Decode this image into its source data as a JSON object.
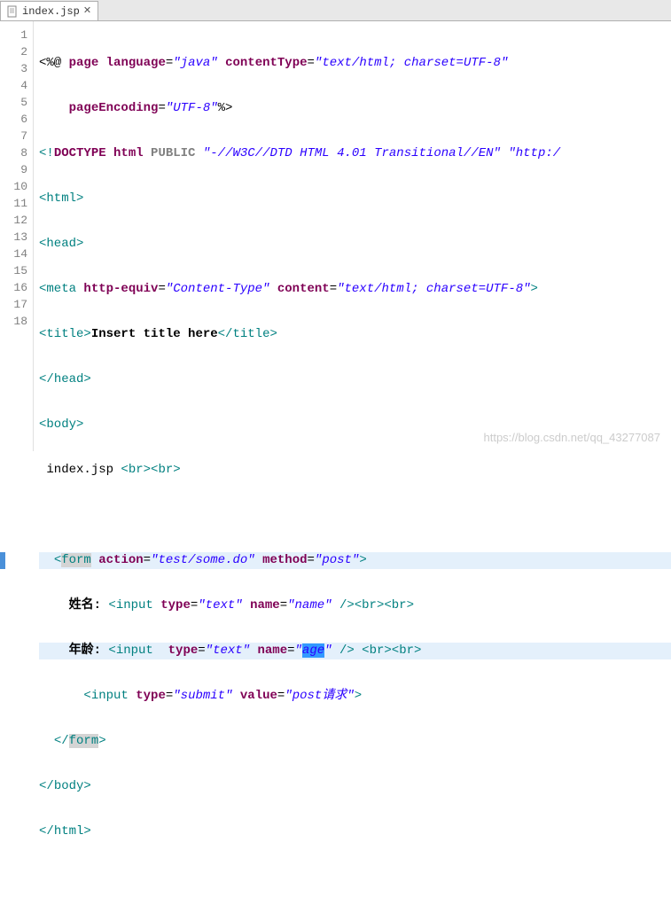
{
  "tab": {
    "filename": "index.jsp",
    "close_icon": "close-icon"
  },
  "watermark": "https://blog.csdn.net/qq_43277087",
  "gutter": {
    "lines": [
      "1",
      "2",
      "3",
      "4",
      "5",
      "6",
      "7",
      "8",
      "9",
      "10",
      "11",
      "12",
      "13",
      "14",
      "15",
      "16",
      "17",
      "18"
    ],
    "fold_at": [
      4,
      9,
      12
    ]
  },
  "code": {
    "l1": {
      "open": "<%@",
      "directive": "page",
      "a1": "language",
      "v1": "\"java\"",
      "a2": "contentType",
      "v2": "\"text/html; charset=UTF-8\""
    },
    "l2": {
      "a1": "pageEncoding",
      "v1": "\"UTF-8\"",
      "close": "%>"
    },
    "l3": {
      "open": "<!",
      "kw": "DOCTYPE",
      "nm": "html",
      "pub": "PUBLIC",
      "v1": "\"-//W3C//DTD HTML 4.01 Transitional//EN\"",
      "v2": "\"http:/"
    },
    "l4": {
      "open": "<",
      "tag": "html",
      "close": ">"
    },
    "l5": {
      "open": "<",
      "tag": "head",
      "close": ">"
    },
    "l6": {
      "open": "<",
      "tag": "meta",
      "a1": "http-equiv",
      "v1": "\"Content-Type\"",
      "a2": "content",
      "v2": "\"text/html; charset=UTF-8\"",
      "close": ">"
    },
    "l7": {
      "open": "<",
      "tag": "title",
      "close": ">",
      "text": "Insert title here",
      "open2": "</",
      "tag2": "title",
      "close2": ">"
    },
    "l8": {
      "open": "</",
      "tag": "head",
      "close": ">"
    },
    "l9": {
      "open": "<",
      "tag": "body",
      "close": ">"
    },
    "l10": {
      "text": "index.jsp ",
      "open": "<",
      "tag": "br",
      "close": "><",
      "tag2": "br",
      "close2": ">"
    },
    "l11": "",
    "l12": {
      "open": "<",
      "tag": "form",
      "a1": "action",
      "v1": "\"test/some.do\"",
      "a2": "method",
      "v2": "\"post\"",
      "close": ">"
    },
    "l13": {
      "label": "姓名: ",
      "open": "<",
      "tag": "input",
      "a1": "type",
      "v1": "\"text\"",
      "a2": "name",
      "v2": "\"name\"",
      "close": "/><",
      "tag2": "br",
      "mid": "><",
      "tag3": "br",
      "close2": ">"
    },
    "l14": {
      "label": "年龄: ",
      "open": "<",
      "tag": "input",
      "a1": "type",
      "v1": "\"text\"",
      "a2": "name",
      "v2_open": "\"",
      "v2_sel": "age",
      "v2_close": "\"",
      "close": "/> <",
      "tag2": "br",
      "mid": "><",
      "tag3": "br",
      "close2": ">"
    },
    "l15": {
      "open": "<",
      "tag": "input",
      "a1": "type",
      "v1": "\"submit\"",
      "a2": "value",
      "v2": "\"post请求\"",
      "close": ">"
    },
    "l16": {
      "open": "</",
      "tag": "form",
      "close": ">"
    },
    "l17": {
      "open": "</",
      "tag": "body",
      "close": ">"
    },
    "l18": {
      "open": "</",
      "tag": "html",
      "close": ">"
    }
  }
}
